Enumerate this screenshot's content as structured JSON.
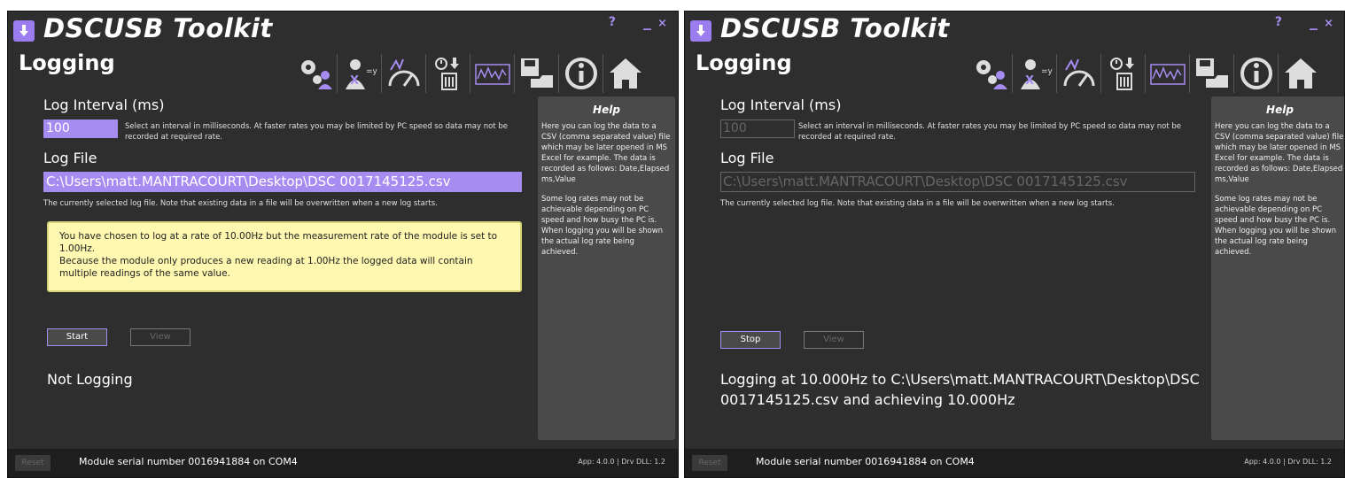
{
  "common": {
    "app_title": "DSCUSB Toolkit",
    "page_title": "Logging",
    "help_button": "?",
    "minimize_button": "_",
    "close_button": "×",
    "interval_label": "Log Interval (ms)",
    "interval_value": "100",
    "interval_hint": "Select an interval in milliseconds. At faster rates you may be limited by PC speed so data may not be recorded at required rate.",
    "file_label": "Log File",
    "file_value": "C:\\Users\\matt.MANTRACOURT\\Desktop\\DSC 0017145125.csv",
    "file_hint": "The currently selected log file. Note that existing data in a file will be overwritten when a new log starts.",
    "view_label": "View",
    "help_title": "Help",
    "help_p1": "Here you can log the data to a CSV (comma separated value) file which may be later opened in MS Excel for example.",
    "help_p1b": "The data is recorded as follows: Date,Elapsed ms,Value",
    "help_p2": "Some log rates may not be achievable depending on PC speed and how busy the PC is. When logging you will be shown the actual log rate being achieved.",
    "reset_label": "Reset",
    "serial_text": "Module serial number 0016941884 on COM4",
    "version_text": "App: 4.0.0 | Drv DLL: 1.2"
  },
  "left": {
    "warning_line1": "You have chosen to log at a rate of 10.00Hz but the measurement rate of the module is set to 1.00Hz.",
    "warning_line2": "Because the module only produces a new reading at 1.00Hz the logged data will contain multiple readings of the same value.",
    "start_label": "Start",
    "status_text": "Not Logging"
  },
  "right": {
    "stop_label": "Stop",
    "status_text": "Logging at 10.000Hz to C:\\Users\\matt.MANTRACOURT\\Desktop\\DSC 0017145125.csv and achieving 10.000Hz"
  },
  "colors": {
    "accent": "#a68cf0",
    "background": "#2e2e2e",
    "panel": "#4a4a4a",
    "warning_bg": "#fff8b0"
  },
  "toolbar_icons": [
    "settings-user-icon",
    "calibration-icon",
    "gauge-icon",
    "clock-download-icon",
    "chart-icon",
    "save-icon",
    "info-icon",
    "home-icon"
  ]
}
